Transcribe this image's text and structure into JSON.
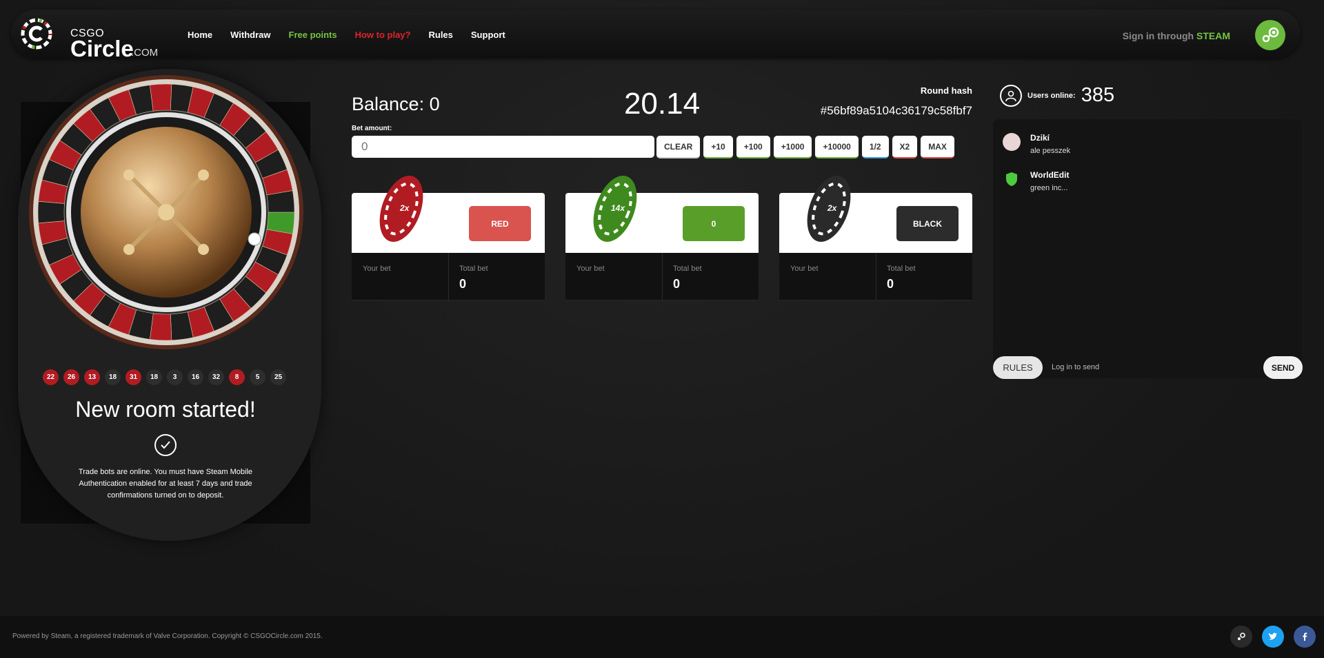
{
  "header": {
    "logo_small": "CSGO",
    "logo_big": "Circle",
    "logo_suffix": ".COM",
    "nav": [
      {
        "label": "Home"
      },
      {
        "label": "Withdraw"
      },
      {
        "label": "Free points"
      },
      {
        "label": "How to play?"
      },
      {
        "label": "Rules"
      },
      {
        "label": "Support"
      }
    ],
    "signin_prefix": "Sign in through",
    "signin_steam": "STEAM",
    "accent_green": "#76c442",
    "accent_red": "#e0232a"
  },
  "roulette": {
    "history": [
      {
        "n": "22",
        "color": "red"
      },
      {
        "n": "26",
        "color": "red"
      },
      {
        "n": "13",
        "color": "red"
      },
      {
        "n": "18",
        "color": "black"
      },
      {
        "n": "31",
        "color": "red"
      },
      {
        "n": "18",
        "color": "black"
      },
      {
        "n": "3",
        "color": "black"
      },
      {
        "n": "16",
        "color": "black"
      },
      {
        "n": "32",
        "color": "black"
      },
      {
        "n": "8",
        "color": "red"
      },
      {
        "n": "5",
        "color": "black"
      },
      {
        "n": "25",
        "color": "black"
      }
    ],
    "room_title": "New room started!",
    "room_message": "Trade bots are online. You must have Steam Mobile Authentication enabled for at least 7 days and trade confirmations turned on to deposit."
  },
  "betting": {
    "balance_label": "Balance: 0",
    "timer": "20.14",
    "round_hash_label": "Round hash",
    "round_hash": "#56bf89a5104c36179c58fbf7",
    "bet_amount_label": "Bet amount:",
    "bet_placeholder": "0",
    "buttons": [
      "CLEAR",
      "+10",
      "+100",
      "+1000",
      "+10000",
      "1/2",
      "X2",
      "MAX"
    ],
    "cards": [
      {
        "multiplier": "2x",
        "button": "RED",
        "color": "#d9534f",
        "your_bet_label": "Your bet",
        "total_bet_label": "Total bet",
        "total_bet": "0"
      },
      {
        "multiplier": "14x",
        "button": "0",
        "color": "#5a9e2a",
        "your_bet_label": "Your bet",
        "total_bet_label": "Total bet",
        "total_bet": "0"
      },
      {
        "multiplier": "2x",
        "button": "BLACK",
        "color": "#2c2c2c",
        "your_bet_label": "Your bet",
        "total_bet_label": "Total bet",
        "total_bet": "0"
      }
    ]
  },
  "chat": {
    "users_online_label": "Users online:",
    "users_online": "385",
    "messages": [
      {
        "name": "Dzikí",
        "text": "ale pesszek"
      },
      {
        "name": "WorldEdit",
        "text": "green inc..."
      }
    ],
    "rules_label": "RULES",
    "login_hint": "Log in to send",
    "send_label": "SEND"
  },
  "footer": {
    "text": "Powered by Steam, a registered trademark of Valve Corporation. Copyright © CSGOCircle.com 2015.",
    "social": [
      {
        "icon": "steam-icon",
        "color": "#2a2a2a"
      },
      {
        "icon": "twitter-icon",
        "color": "#1da1f2"
      },
      {
        "icon": "facebook-icon",
        "color": "#3b5998"
      }
    ]
  }
}
